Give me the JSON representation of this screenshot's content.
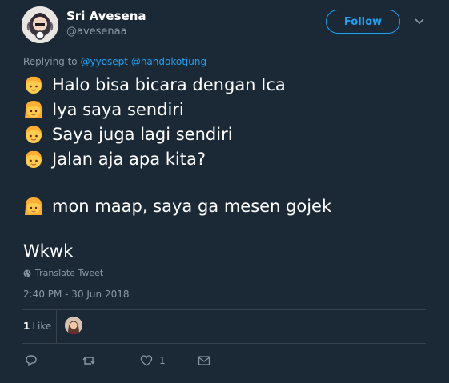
{
  "user": {
    "display_name": "Sri Avesena",
    "handle": "@avesenaa"
  },
  "follow_label": "Follow",
  "reply": {
    "prefix": "Replying to",
    "mentions": [
      "@yyosept",
      "@handokotjung"
    ]
  },
  "tweet": {
    "lines": [
      {
        "emoji": "boy-emoji",
        "text": "Halo bisa bicara dengan Ica"
      },
      {
        "emoji": "girl-emoji",
        "text": "Iya saya sendiri"
      },
      {
        "emoji": "boy-emoji",
        "text": "Saya juga lagi sendiri"
      },
      {
        "emoji": "boy-emoji",
        "text": "Jalan aja apa kita?"
      },
      {
        "emoji": "girl-emoji",
        "text": "mon maap, saya ga mesen gojek"
      }
    ],
    "footer_text": "Wkwk"
  },
  "translate_label": "Translate Tweet",
  "timestamp": "2:40 PM - 30 Jun 2018",
  "likes": {
    "count": "1",
    "label": "Like"
  },
  "actions": {
    "reply_icon": "reply-icon",
    "retweet_icon": "retweet-icon",
    "like_icon": "heart-icon",
    "like_count": "1",
    "dm_icon": "envelope-icon"
  },
  "colors": {
    "background": "#1b2836",
    "accent": "#1da1f2",
    "muted": "#8899a6",
    "divider": "#38444d"
  }
}
